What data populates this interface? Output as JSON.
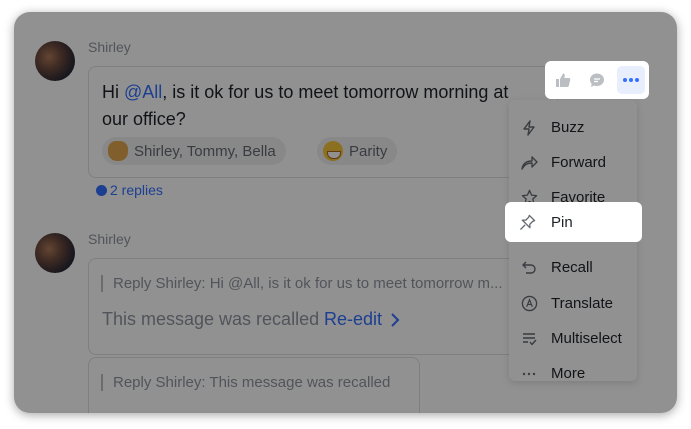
{
  "thread": {
    "message1": {
      "sender": "Shirley",
      "text_before": "Hi ",
      "mention": "@All",
      "text_line1_after": ", is it ok for us to meet tomorrow morning at",
      "text_line2": "our office?",
      "reactions": [
        {
          "emoji": "clapping-hands-icon",
          "users": "Shirley, Tommy, Bella"
        },
        {
          "emoji": "grinning-face-icon",
          "users": "Parity"
        }
      ],
      "replies_label": "2 replies"
    },
    "message2": {
      "sender": "Shirley",
      "quote": "Reply Shirley: Hi @All, is it ok for us to meet tomorrow m...",
      "recalled_text": "This message was recalled",
      "reedit_label": "Re-edit"
    },
    "message3": {
      "quote": "Reply Shirley: This message was recalled"
    }
  },
  "toolbar": {
    "buttons": [
      "thumbs-up-icon",
      "reply-bubble-icon",
      "more-icon"
    ]
  },
  "menu": {
    "items": [
      {
        "label": "Buzz",
        "icon": "lightning-icon"
      },
      {
        "label": "Forward",
        "icon": "forward-icon"
      },
      {
        "label": "Favorite",
        "icon": "star-icon"
      },
      {
        "label": "Pin",
        "icon": "pin-icon"
      },
      {
        "label": "Recall",
        "icon": "undo-icon"
      },
      {
        "label": "Translate",
        "icon": "translate-icon"
      },
      {
        "label": "Multiselect",
        "icon": "multiselect-icon"
      },
      {
        "label": "More",
        "icon": "ellipsis-icon"
      }
    ]
  },
  "colors": {
    "accent": "#3370ff",
    "muted_text": "#8f959e",
    "overlay": "rgba(0,0,0,0.43)"
  }
}
